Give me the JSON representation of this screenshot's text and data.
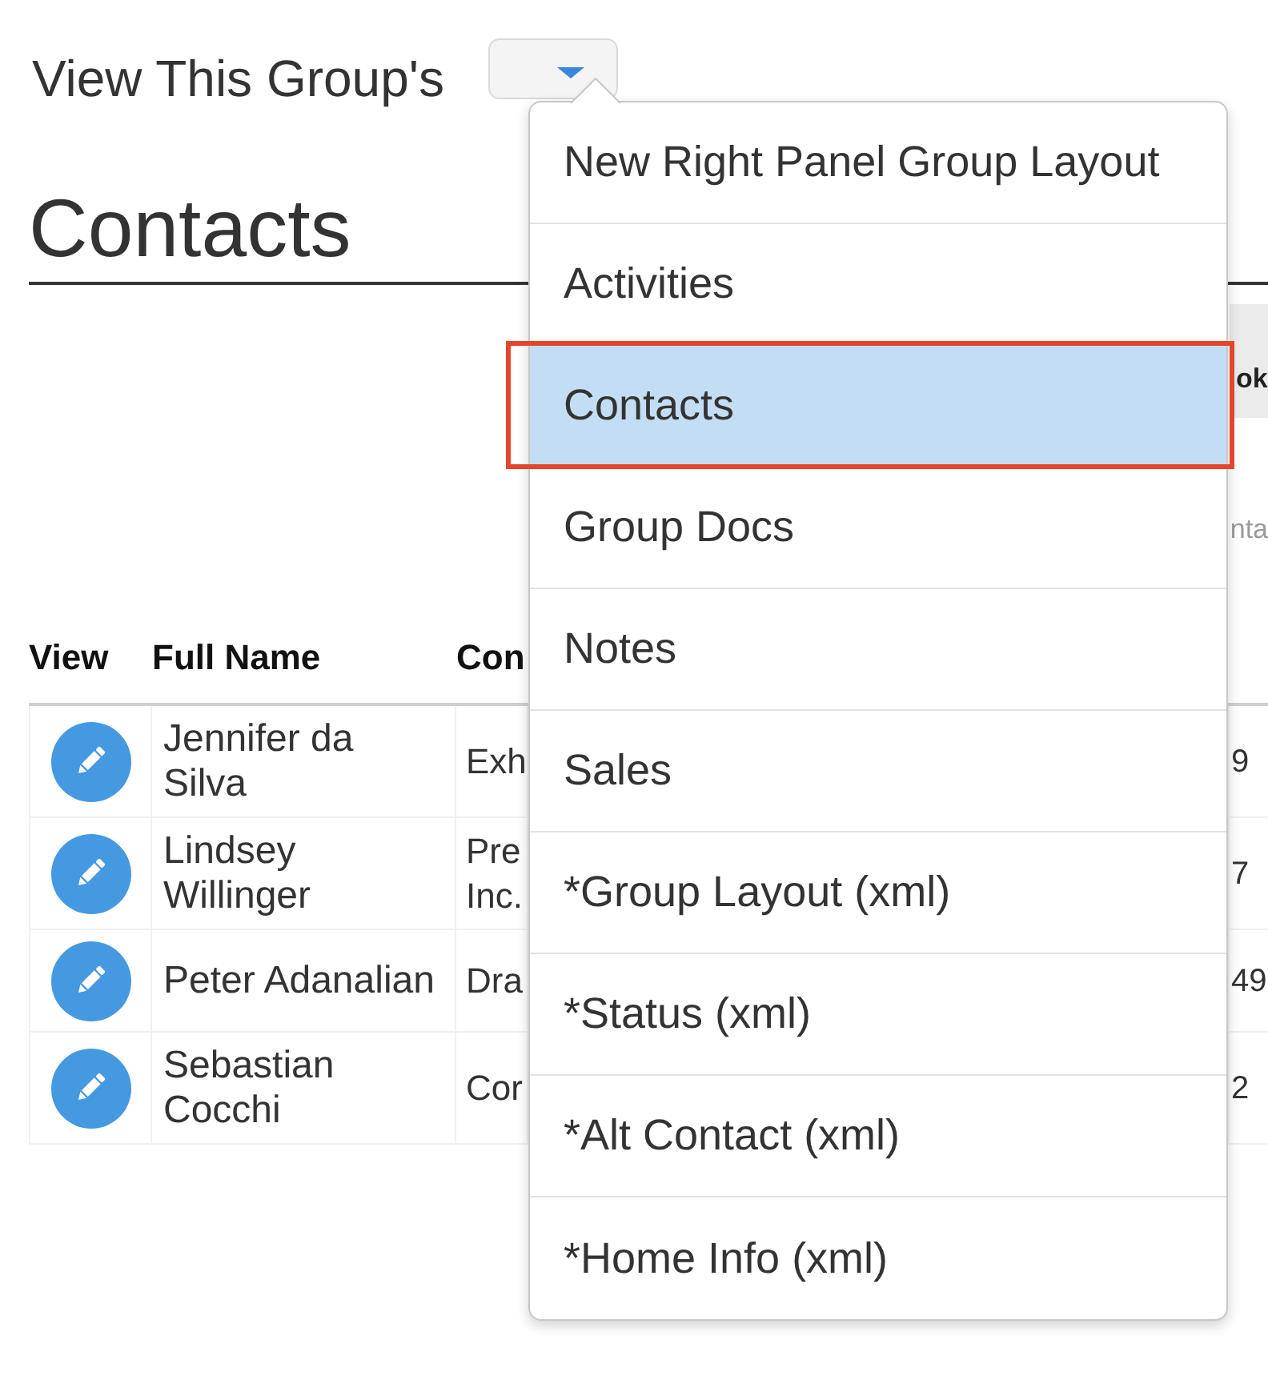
{
  "group_view": {
    "label": "View This Group's",
    "dropdown": {
      "expanded": true,
      "items": [
        {
          "label": "New Right Panel Group Layout",
          "selected": false,
          "highlighted": false
        },
        {
          "label": "Activities",
          "selected": false,
          "highlighted": false
        },
        {
          "label": "Contacts",
          "selected": true,
          "highlighted": true
        },
        {
          "label": "Group Docs",
          "selected": false,
          "highlighted": false
        },
        {
          "label": "Notes",
          "selected": false,
          "highlighted": false
        },
        {
          "label": "Sales",
          "selected": false,
          "highlighted": false
        },
        {
          "label": "*Group Layout (xml)",
          "selected": false,
          "highlighted": false
        },
        {
          "label": "*Status (xml)",
          "selected": false,
          "highlighted": false
        },
        {
          "label": "*Alt Contact (xml)",
          "selected": false,
          "highlighted": false
        },
        {
          "label": "*Home Info (xml)",
          "selected": false,
          "highlighted": false
        }
      ]
    }
  },
  "heading": "Contacts",
  "section_bar": {
    "label": "ok"
  },
  "caption": "nta",
  "table": {
    "columns": [
      "View",
      "Full Name",
      "Con"
    ],
    "rows": [
      {
        "full_name": "Jennifer da Silva",
        "column_3": "Exh",
        "column_4": "9"
      },
      {
        "full_name": "Lindsey Willinger",
        "column_3": "Pre Inc.",
        "column_4": "7"
      },
      {
        "full_name": "Peter Adanalian",
        "column_3": "Dra",
        "column_4": "49"
      },
      {
        "full_name": "Sebastian Cocchi",
        "column_3": "Cor",
        "column_4": "2"
      }
    ]
  }
}
